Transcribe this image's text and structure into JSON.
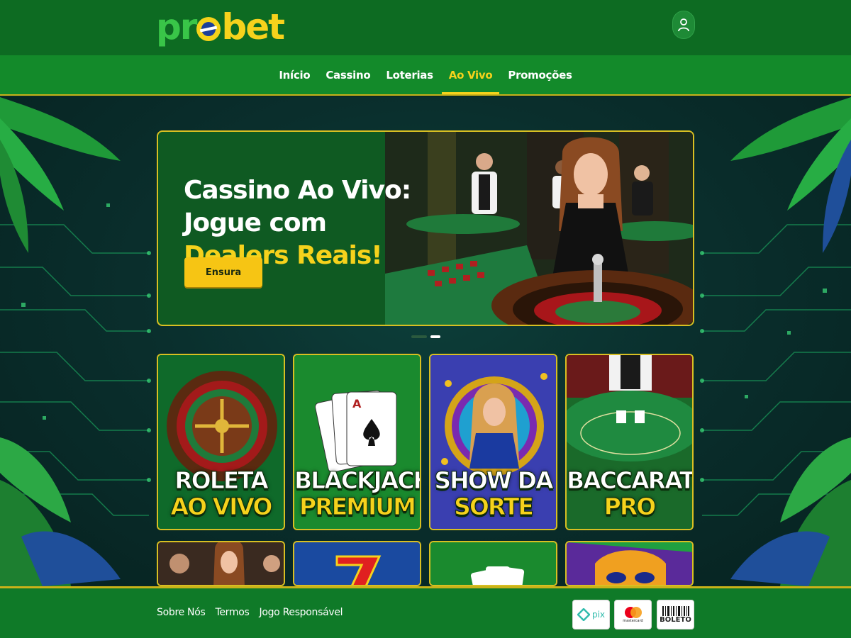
{
  "brand": {
    "logo_left": "pr",
    "logo_right": "bet"
  },
  "nav": {
    "items": [
      {
        "label": "Início"
      },
      {
        "label": "Cassino"
      },
      {
        "label": "Loterias"
      },
      {
        "label": "Ao Vivo",
        "active": true
      },
      {
        "label": "Promoções"
      }
    ]
  },
  "hero": {
    "title_part1": "Cassino Ao Vivo: Jogue com ",
    "title_highlight": "Dealers Reais!",
    "button_label": "Ensura",
    "slides": 2,
    "active_slide": 2
  },
  "games": [
    {
      "line1": "ROLETA",
      "line2": "AO VIVO"
    },
    {
      "line1": "BLACKJACK",
      "line2": "PREMIUM"
    },
    {
      "line1": "SHOW DA",
      "line2": "SORTE"
    },
    {
      "line1": "BACCARAT",
      "line2": "PRO"
    }
  ],
  "footer": {
    "links": [
      {
        "label": "Sobre Nós"
      },
      {
        "label": "Termos"
      },
      {
        "label": "Jogo Responsável"
      }
    ],
    "payments": [
      {
        "name": "pix",
        "label": "pix"
      },
      {
        "name": "mastercard",
        "label": "mastercard"
      },
      {
        "name": "boleto",
        "label": "BOLETO"
      }
    ]
  },
  "colors": {
    "brand_green": "#0d6b22",
    "accent_yellow": "#f6d21c",
    "card_border": "#d8bf22"
  },
  "icons": {
    "user": "user-icon",
    "logo_globe": "brazil-globe-icon"
  }
}
